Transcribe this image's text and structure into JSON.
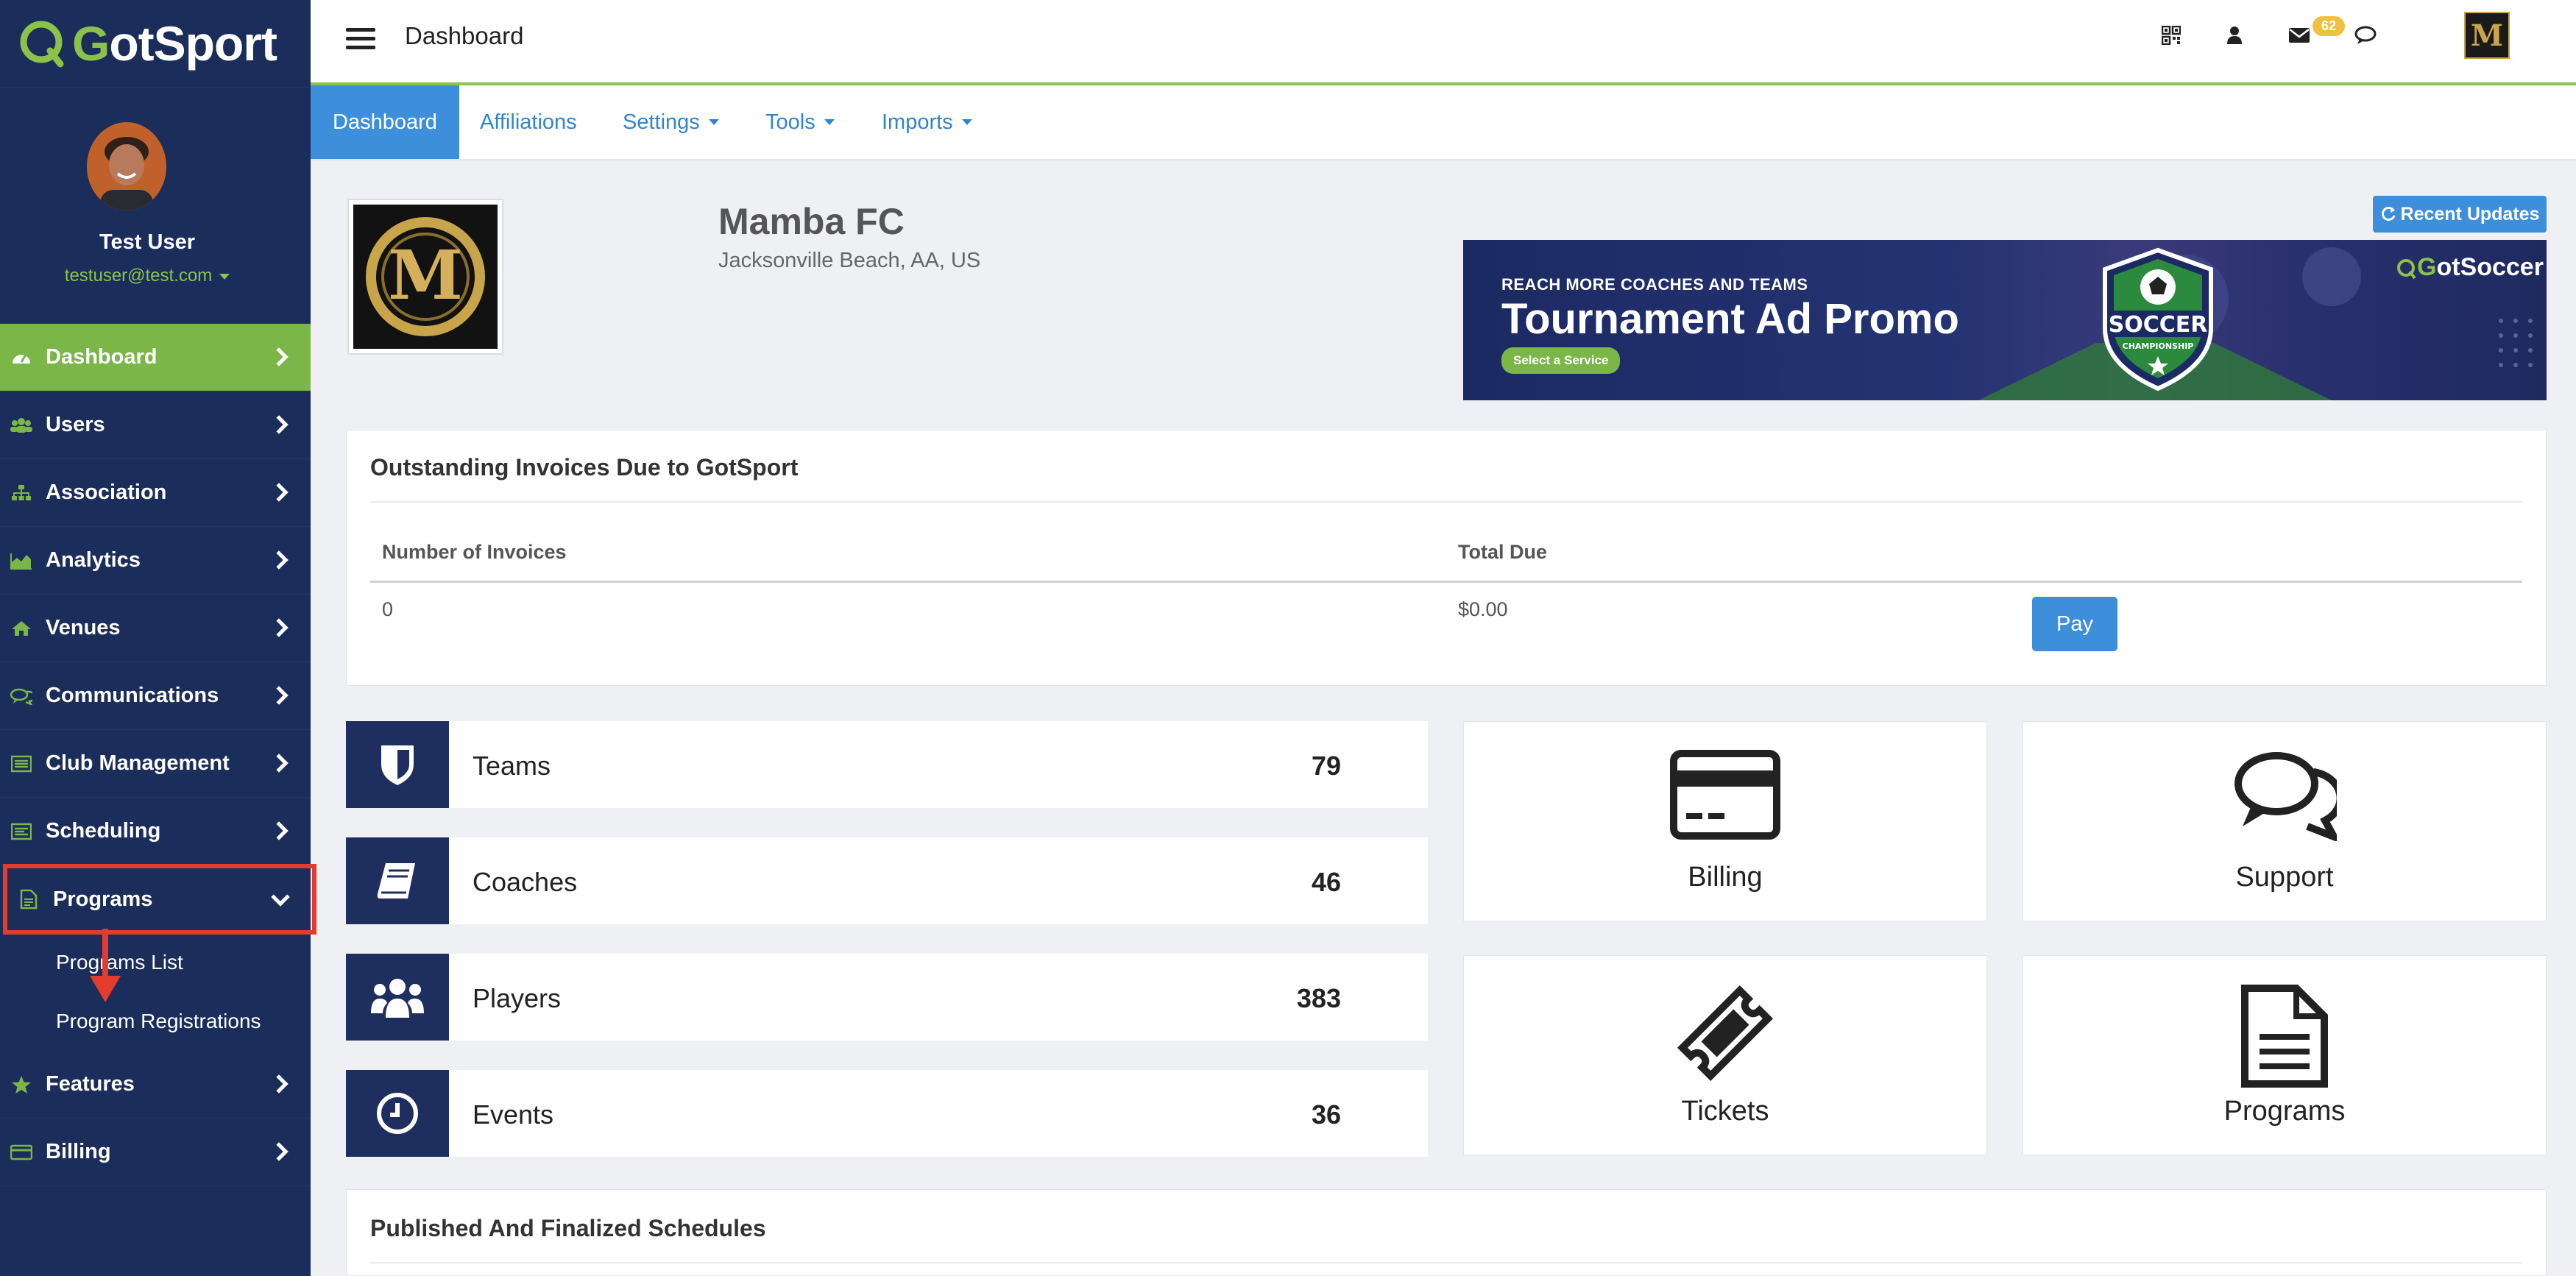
{
  "app": {
    "logo_text_prefix": "G",
    "logo_text": "otSport"
  },
  "user": {
    "name": "Test User",
    "email": "testuser@test.com"
  },
  "sidebar": {
    "items": [
      {
        "label": "Dashboard",
        "icon": "dashboard-icon",
        "active": true
      },
      {
        "label": "Users",
        "icon": "users-icon"
      },
      {
        "label": "Association",
        "icon": "sitemap-icon"
      },
      {
        "label": "Analytics",
        "icon": "area-chart-icon"
      },
      {
        "label": "Venues",
        "icon": "home-icon"
      },
      {
        "label": "Communications",
        "icon": "comments-icon"
      },
      {
        "label": "Club Management",
        "icon": "list-icon"
      },
      {
        "label": "Scheduling",
        "icon": "calendar-list-icon"
      },
      {
        "label": "Programs",
        "icon": "file-icon",
        "expanded": true
      },
      {
        "label": "Features",
        "icon": "star-icon"
      },
      {
        "label": "Billing",
        "icon": "credit-card-icon"
      }
    ],
    "program_subitems": [
      "Programs List",
      "Program Registrations"
    ]
  },
  "topbar": {
    "title": "Dashboard",
    "mail_count": "62",
    "icons": [
      "qr-code-icon",
      "user-icon",
      "envelope-icon",
      "chat-icon"
    ]
  },
  "subtabs": [
    {
      "label": "Dashboard",
      "active": true
    },
    {
      "label": "Affiliations"
    },
    {
      "label": "Settings",
      "dropdown": true
    },
    {
      "label": "Tools",
      "dropdown": true
    },
    {
      "label": "Imports",
      "dropdown": true
    }
  ],
  "club": {
    "name": "Mamba FC",
    "location": "Jacksonville Beach, AA, US",
    "logo_letter": "M"
  },
  "recent_updates_label": "Recent Updates",
  "ad": {
    "kicker": "REACH MORE COACHES AND TEAMS",
    "title": "Tournament Ad Promo",
    "cta": "Select a Service",
    "badge_text": "SOCCER",
    "badge_sub": "CHAMPIONSHIP",
    "brand_prefix": "G",
    "brand": "otSoccer"
  },
  "invoices": {
    "title": "Outstanding Invoices Due to GotSport",
    "columns": [
      "Number of Invoices",
      "Total Due"
    ],
    "row": {
      "count": "0",
      "total": "$0.00"
    },
    "pay_label": "Pay"
  },
  "stats": [
    {
      "label": "Teams",
      "count": "79",
      "icon": "shield-icon"
    },
    {
      "label": "Coaches",
      "count": "46",
      "icon": "book-icon"
    },
    {
      "label": "Players",
      "count": "383",
      "icon": "users-icon"
    },
    {
      "label": "Events",
      "count": "36",
      "icon": "clock-icon"
    }
  ],
  "tiles": [
    {
      "label": "Billing",
      "icon": "credit-card-icon"
    },
    {
      "label": "Support",
      "icon": "comments-icon"
    },
    {
      "label": "Tickets",
      "icon": "ticket-icon"
    },
    {
      "label": "Programs",
      "icon": "file-text-icon"
    }
  ],
  "schedules": {
    "title": "Published And Finalized Schedules"
  },
  "colors": {
    "sidebar_bg": "#1b2d5b",
    "accent_green": "#7ab648",
    "accent_blue": "#3d8fdc",
    "highlight_red": "#e23c2c"
  }
}
